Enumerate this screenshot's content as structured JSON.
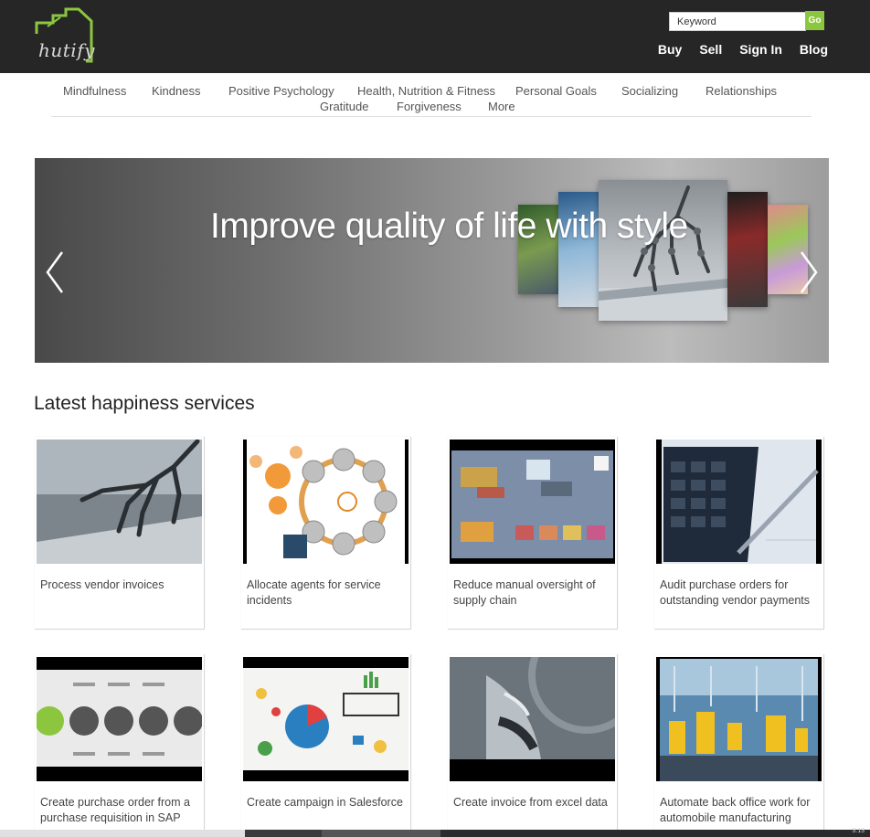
{
  "header": {
    "logo_text": "hutify",
    "search": {
      "placeholder": "Keyword",
      "button_label": "Go"
    },
    "links": [
      "Buy",
      "Sell",
      "Sign In",
      "Blog"
    ]
  },
  "categories": [
    "Mindfulness",
    "Kindness",
    "Positive Psychology",
    "Health, Nutrition & Fitness",
    "Personal Goals",
    "Socializing",
    "Relationships",
    "Gratitude",
    "Forgiveness",
    "More"
  ],
  "banner": {
    "headline": "Improve quality of life with style"
  },
  "section": {
    "title": "Latest happiness services",
    "cards": [
      {
        "title": "Process vendor invoices",
        "image": "robot-hand-laptop-image"
      },
      {
        "title": "Allocate agents for service incidents",
        "image": "agent-network-diagram-image"
      },
      {
        "title": "Reduce manual oversight of supply chain",
        "image": "supply-chain-diagram-image"
      },
      {
        "title": "Audit purchase orders for outstanding vendor payments",
        "image": "calculator-pen-image"
      },
      {
        "title": "Create purchase order from a purchase requisition in SAP",
        "image": "process-flow-image"
      },
      {
        "title": "Create campaign in Salesforce",
        "image": "strategy-sketch-image"
      },
      {
        "title": "Create invoice from excel data",
        "image": "robot-head-image"
      },
      {
        "title": "Automate back office work for automobile manufacturing",
        "image": "factory-robots-image"
      }
    ]
  },
  "taskbar": {
    "time": "3:13"
  }
}
